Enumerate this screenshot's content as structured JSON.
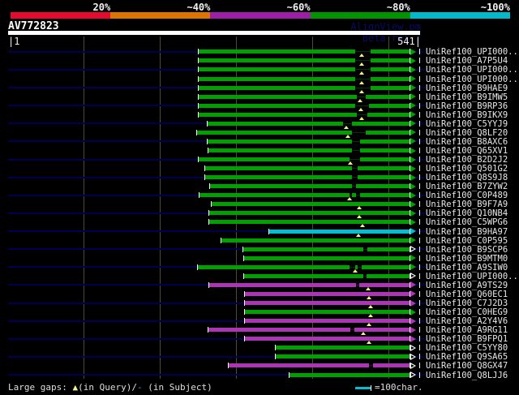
{
  "header": {
    "watermark": "AlignView.pm Beta rel.7",
    "axis": {
      "start_label": "|1",
      "end_label": "541|"
    }
  },
  "footer": {
    "legend": {
      "prefix": "Large gaps: ",
      "query_symbol": "▲",
      "mid": "(in Query)/",
      "subject_symbol": "-",
      "suffix": " (in Subject)"
    },
    "scale_hint": "=100char."
  },
  "colors": {
    "background": "#000000",
    "row_track_navy": "#000052",
    "gridline": "#4c4c30",
    "gap_marker_yellow": "#f2f288",
    "bins": {
      "green": "#00a000",
      "cyan": "#00bfd2",
      "purple": "#ab35b5"
    },
    "bins_dim": {
      "green": "#003400",
      "cyan": "#005a62",
      "purple": "#3a0042"
    },
    "scale_segments": [
      "#e50b2e",
      "#dd7300",
      "#9c20a6",
      "#009500",
      "#00b9cb"
    ]
  },
  "chart_data": {
    "type": "bar",
    "subtype": "sequence-alignment-overview",
    "title": "AV772823",
    "query": {
      "name": "AV772823",
      "length": 541
    },
    "identity_scale": [
      {
        "label": "20%",
        "color": "#e50b2e"
      },
      {
        "label": "~40%",
        "color": "#dd7300"
      },
      {
        "label": "~60%",
        "color": "#9c20a6"
      },
      {
        "label": "~80%",
        "color": "#009500"
      },
      {
        "label": "~100%",
        "color": "#00b9cb"
      }
    ],
    "x_axis": {
      "min": 1,
      "max": 541,
      "gridlines": [
        100,
        200,
        300,
        400,
        500
      ]
    },
    "legend_position": "top",
    "rows": [
      {
        "label": "UniRef100_UPI000..",
        "bin": "green",
        "query_start": 251,
        "query_end": 527,
        "subject_gap_segments": [
          [
            456,
            476
          ]
        ],
        "query_gap_markers": [
          464
        ],
        "arrow": "filled"
      },
      {
        "label": "UniRef100_A7P5U4",
        "bin": "green",
        "query_start": 251,
        "query_end": 527,
        "subject_gap_segments": [
          [
            456,
            476
          ]
        ],
        "query_gap_markers": [
          464
        ],
        "arrow": "filled"
      },
      {
        "label": "UniRef100_UPI000..",
        "bin": "green",
        "query_start": 251,
        "query_end": 527,
        "subject_gap_segments": [
          [
            456,
            476
          ]
        ],
        "query_gap_markers": [
          464
        ],
        "arrow": "filled"
      },
      {
        "label": "UniRef100_UPI000..",
        "bin": "green",
        "query_start": 251,
        "query_end": 527,
        "subject_gap_segments": [
          [
            456,
            476
          ]
        ],
        "query_gap_markers": [
          464
        ],
        "arrow": "filled"
      },
      {
        "label": "UniRef100_B9HAE9",
        "bin": "green",
        "query_start": 251,
        "query_end": 527,
        "subject_gap_segments": [
          [
            456,
            476
          ]
        ],
        "query_gap_markers": [
          464
        ],
        "arrow": "filled"
      },
      {
        "label": "UniRef100_B9IMW5",
        "bin": "green",
        "query_start": 251,
        "query_end": 527,
        "subject_gap_segments": [
          [
            458,
            470
          ]
        ],
        "query_gap_markers": [
          462
        ],
        "arrow": "filled"
      },
      {
        "label": "UniRef100_B9RP36",
        "bin": "green",
        "query_start": 251,
        "query_end": 527,
        "subject_gap_segments": [
          [
            456,
            474
          ]
        ],
        "query_gap_markers": [
          463
        ],
        "arrow": "filled"
      },
      {
        "label": "UniRef100_B9IKX9",
        "bin": "green",
        "query_start": 251,
        "query_end": 527,
        "subject_gap_segments": [
          [
            458,
            472
          ]
        ],
        "query_gap_markers": [
          464
        ],
        "arrow": "filled"
      },
      {
        "label": "UniRef100_C5YYJ9",
        "bin": "green",
        "query_start": 262,
        "query_end": 527,
        "subject_gap_segments": [
          [
            440,
            452
          ]
        ],
        "query_gap_markers": [
          444
        ],
        "arrow": "filled"
      },
      {
        "label": "UniRef100_Q8LF20",
        "bin": "green",
        "query_start": 249,
        "query_end": 527,
        "subject_gap_segments": [
          [
            452,
            470
          ]
        ],
        "query_gap_markers": [
          446
        ],
        "arrow": "filled"
      },
      {
        "label": "UniRef100_B8AXC6",
        "bin": "green",
        "query_start": 262,
        "query_end": 527,
        "subject_gap_segments": [
          [
            452,
            462
          ]
        ],
        "query_gap_markers": [],
        "arrow": "filled"
      },
      {
        "label": "UniRef100_Q65XV1",
        "bin": "green",
        "query_start": 263,
        "query_end": 527,
        "subject_gap_segments": [
          [
            452,
            462
          ]
        ],
        "query_gap_markers": [],
        "arrow": "filled"
      },
      {
        "label": "UniRef100_B2D2J2",
        "bin": "green",
        "query_start": 251,
        "query_end": 527,
        "subject_gap_segments": [
          [
            448,
            462
          ]
        ],
        "query_gap_markers": [
          450
        ],
        "arrow": "filled"
      },
      {
        "label": "UniRef100_Q501G2",
        "bin": "green",
        "query_start": 259,
        "query_end": 527,
        "subject_gap_segments": [
          [
            452,
            459
          ]
        ],
        "query_gap_markers": [],
        "arrow": "filled"
      },
      {
        "label": "UniRef100_Q8S9J8",
        "bin": "green",
        "query_start": 259,
        "query_end": 527,
        "subject_gap_segments": [
          [
            452,
            459
          ]
        ],
        "query_gap_markers": [],
        "arrow": "filled"
      },
      {
        "label": "UniRef100_B7ZYW2",
        "bin": "green",
        "query_start": 266,
        "query_end": 527,
        "subject_gap_segments": [
          [
            452,
            457
          ]
        ],
        "query_gap_markers": [],
        "arrow": "filled"
      },
      {
        "label": "UniRef100_C0P489",
        "bin": "green",
        "query_start": 252,
        "query_end": 527,
        "subject_gap_segments": [
          [
            448,
            452
          ],
          [
            457,
            462
          ]
        ],
        "query_gap_markers": [
          448
        ],
        "arrow": "filled"
      },
      {
        "label": "UniRef100_B9F7A9",
        "bin": "green",
        "query_start": 268,
        "query_end": 527,
        "subject_gap_segments": [],
        "query_gap_markers": [
          461
        ],
        "arrow": "filled"
      },
      {
        "label": "UniRef100_Q10NB4",
        "bin": "green",
        "query_start": 265,
        "query_end": 527,
        "subject_gap_segments": [],
        "query_gap_markers": [
          461
        ],
        "arrow": "filled"
      },
      {
        "label": "UniRef100_C5WPG6",
        "bin": "green",
        "query_start": 265,
        "query_end": 527,
        "subject_gap_segments": [],
        "query_gap_markers": [
          466
        ],
        "arrow": "filled"
      },
      {
        "label": "UniRef100_B9HA97",
        "bin": "cyan",
        "query_start": 343,
        "query_end": 527,
        "subject_gap_segments": [],
        "query_gap_markers": [
          460
        ],
        "arrow": "filled"
      },
      {
        "label": "UniRef100_C0P595",
        "bin": "green",
        "query_start": 281,
        "query_end": 527,
        "subject_gap_segments": [],
        "query_gap_markers": [],
        "arrow": "filled"
      },
      {
        "label": "UniRef100_B9SCP6",
        "bin": "green",
        "query_start": 309,
        "query_end": 527,
        "subject_gap_segments": [
          [
            467,
            472
          ]
        ],
        "query_gap_markers": [],
        "arrow": "hollow"
      },
      {
        "label": "UniRef100_B9MTM0",
        "bin": "green",
        "query_start": 310,
        "query_end": 527,
        "subject_gap_segments": [],
        "query_gap_markers": [],
        "arrow": "filled"
      },
      {
        "label": "UniRef100_A9SIW0",
        "bin": "green",
        "query_start": 250,
        "query_end": 527,
        "subject_gap_segments": [
          [
            448,
            456
          ],
          [
            459,
            464
          ]
        ],
        "query_gap_markers": [
          456
        ],
        "arrow": "filled"
      },
      {
        "label": "UniRef100_UPI000..",
        "bin": "green",
        "query_start": 310,
        "query_end": 527,
        "subject_gap_segments": [
          [
            467,
            471
          ]
        ],
        "query_gap_markers": [],
        "arrow": "hollow"
      },
      {
        "label": "UniRef100_A9TS29",
        "bin": "purple",
        "query_start": 265,
        "query_end": 527,
        "subject_gap_segments": [
          [
            457,
            461
          ]
        ],
        "query_gap_markers": [
          473
        ],
        "arrow": "filled"
      },
      {
        "label": "UniRef100_Q60EC1",
        "bin": "purple",
        "query_start": 311,
        "query_end": 527,
        "subject_gap_segments": [],
        "query_gap_markers": [
          474
        ],
        "arrow": "filled"
      },
      {
        "label": "UniRef100_C7J2D3",
        "bin": "purple",
        "query_start": 311,
        "query_end": 527,
        "subject_gap_segments": [],
        "query_gap_markers": [
          476
        ],
        "arrow": "filled"
      },
      {
        "label": "UniRef100_C0HEG9",
        "bin": "green",
        "query_start": 311,
        "query_end": 527,
        "subject_gap_segments": [],
        "query_gap_markers": [
          476
        ],
        "arrow": "filled"
      },
      {
        "label": "UniRef100_A2Y4V6",
        "bin": "purple",
        "query_start": 311,
        "query_end": 527,
        "subject_gap_segments": [],
        "query_gap_markers": [
          474
        ],
        "arrow": "filled"
      },
      {
        "label": "UniRef100_A9RG11",
        "bin": "purple",
        "query_start": 263,
        "query_end": 527,
        "subject_gap_segments": [
          [
            450,
            455
          ]
        ],
        "query_gap_markers": [
          467
        ],
        "arrow": "filled"
      },
      {
        "label": "UniRef100_B9FPQ1",
        "bin": "purple",
        "query_start": 311,
        "query_end": 527,
        "subject_gap_segments": [],
        "query_gap_markers": [
          474
        ],
        "arrow": "filled"
      },
      {
        "label": "UniRef100_C5YY80",
        "bin": "green",
        "query_start": 352,
        "query_end": 527,
        "subject_gap_segments": [],
        "query_gap_markers": [],
        "arrow": "hollow"
      },
      {
        "label": "UniRef100_Q9SA65",
        "bin": "green",
        "query_start": 352,
        "query_end": 527,
        "subject_gap_segments": [],
        "query_gap_markers": [],
        "arrow": "hollow"
      },
      {
        "label": "UniRef100_Q8GX47",
        "bin": "purple",
        "query_start": 290,
        "query_end": 527,
        "subject_gap_segments": [
          [
            474,
            479
          ]
        ],
        "query_gap_markers": [],
        "arrow": "hollow"
      },
      {
        "label": "UniRef100_Q8LJJ6",
        "bin": "green",
        "query_start": 370,
        "query_end": 527,
        "subject_gap_segments": [],
        "query_gap_markers": [],
        "arrow": "hollow"
      }
    ]
  }
}
